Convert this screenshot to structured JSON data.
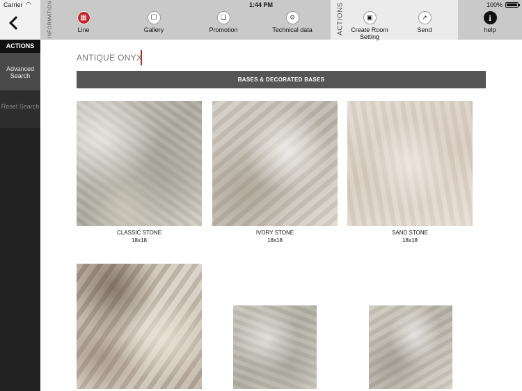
{
  "status_bar": {
    "carrier": "Carrier",
    "time": "1:44 PM",
    "battery": "100%"
  },
  "sidebar": {
    "actions_label": "ACTIONS",
    "advanced_search": "Advanced Search",
    "reset_search": "Reset Search"
  },
  "toolbar": {
    "information_label": "INFORMATION",
    "actions_label": "ACTIONS",
    "info_items": [
      {
        "label": "Line",
        "icon": "grid-icon"
      },
      {
        "label": "Gallery",
        "icon": "gallery-icon"
      },
      {
        "label": "Promotion",
        "icon": "promotion-icon"
      },
      {
        "label": "Technical data",
        "icon": "technical-data-icon"
      }
    ],
    "action_items": [
      {
        "label": "Create Room Setting",
        "icon": "room-setting-icon"
      },
      {
        "label": "Send",
        "icon": "send-icon"
      }
    ],
    "help_label": "help"
  },
  "content": {
    "title": "ANTIQUE ONYX",
    "section_header": "BASES & DECORATED BASES",
    "accent_color": "#c0272d",
    "tiles": [
      {
        "name": "CLASSIC STONE",
        "size": "18x18"
      },
      {
        "name": "IVORY STONE",
        "size": "18x18"
      },
      {
        "name": "SAND STONE",
        "size": "18x18"
      },
      {
        "name": "",
        "size": ""
      },
      {
        "name": "",
        "size": ""
      },
      {
        "name": "",
        "size": ""
      }
    ]
  }
}
